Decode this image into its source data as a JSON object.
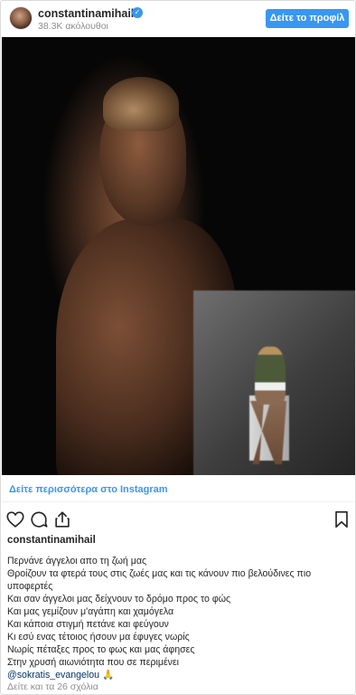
{
  "header": {
    "username": "constantinamihail",
    "verified_badge": "✓",
    "followers": "38.3K ακόλουθοι",
    "profile_button": "Δείτε το προφίλ"
  },
  "photo": {
    "description_icon": "post-photo"
  },
  "links": {
    "more_on_instagram": "Δείτε περισσότερα στο Instagram"
  },
  "actions": {
    "icons": [
      "heart-icon",
      "comment-icon",
      "share-icon",
      "bookmark-icon"
    ]
  },
  "caption": {
    "username": "constantinamihail",
    "lines": [
      "Περνάνε άγγελοι απο τη ζωή μας",
      "Θροίζουν τα φτερά τους στις ζωές μας και τις κάνουν πιο βελούδινες πιο",
      "υποφερτές",
      "Και σαν άγγελοι μας δείχνουν το δρόμο προς το φώς",
      "Και μας γεμίζουν μ'αγάπη και χαμόγελα",
      "Και κάποια στιγμή πετάνε και φεύγουν",
      "Κι εσύ ενας τέτοιος ήσουν μα έφυγες νωρίς",
      "Νωρίς πέταξες προς το φως και μας άφησες",
      "Στην χρυσή αιωνιότητα που σε περιμένει"
    ],
    "mention": "@sokratis_evangelou",
    "mention_emoji": "🙏"
  },
  "comments": {
    "text": "Δείτε και τα 26 σχόλια"
  },
  "colors": {
    "accent": "#3897f0",
    "text": "#262626",
    "muted": "#8e8e8e",
    "border": "#dbdbdb"
  }
}
